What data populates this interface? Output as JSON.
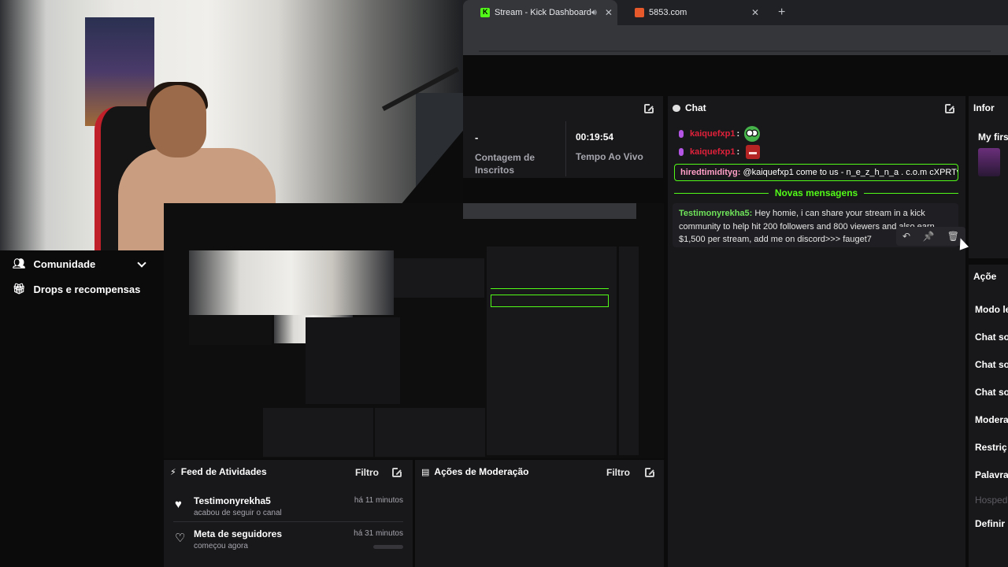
{
  "browser": {
    "tabs": [
      {
        "title": "Stream - Kick Dashboard",
        "favicon": "kick-icon",
        "active": true,
        "audio": true
      },
      {
        "title": "5853.com",
        "favicon": "orange-icon",
        "active": false
      }
    ],
    "new_tab": "+"
  },
  "sidebar": {
    "items": [
      {
        "label": "Comunidade",
        "icon": "community-icon"
      },
      {
        "label": "Drops e recompensas",
        "icon": "gift-icon"
      }
    ]
  },
  "stats": {
    "followers_value": "-",
    "followers_label": "Contagem de Inscritos",
    "live_time_value": "00:19:54",
    "live_time_label": "Tempo Ao Vivo"
  },
  "chat": {
    "title": "Chat",
    "messages": [
      {
        "user": "kaiquefxp1",
        "colon": ":"
      },
      {
        "user": "kaiquefxp1",
        "colon": ":"
      }
    ],
    "highlight": {
      "user": "hiredtimidityg:",
      "text": " @kaiquefxp1 come to us - n_e_z_h_n_a . c.o.m cXPRTv"
    },
    "divider": "Novas mensagens",
    "new_message": {
      "user": "Testimonyrekha5:",
      "text": " Hey homie, i can share your stream in a kick community to help hit 200 followers and 800 viewers and also earn $1,500 per stream, add me on discord>>> fauget7"
    },
    "actions": {
      "reply": "↶",
      "pin": "📌",
      "delete": "🗑"
    }
  },
  "info": {
    "title": "Infor",
    "sub": "My firs"
  },
  "actions_panel": {
    "title": "Açõe",
    "items": [
      "Modo le",
      "Chat so",
      "Chat so",
      "Chat so",
      "Modera",
      "Restriç",
      "Palavra",
      "Hosped",
      "Definir r"
    ]
  },
  "feed": {
    "title": "Feed de Atividades",
    "filter": "Filtro",
    "rows": [
      {
        "name": "Testimonyrekha5",
        "sub": "acabou de seguir o canal",
        "time": "há 11 minutos"
      },
      {
        "name": "Meta de seguidores",
        "sub": "começou agora",
        "time": "há 31 minutos"
      }
    ]
  },
  "moderation": {
    "title": "Ações de Moderação",
    "filter": "Filtro"
  },
  "colors": {
    "kick_green": "#53fc18",
    "panel_bg": "#18181b",
    "page_bg": "#0b0b0c"
  }
}
